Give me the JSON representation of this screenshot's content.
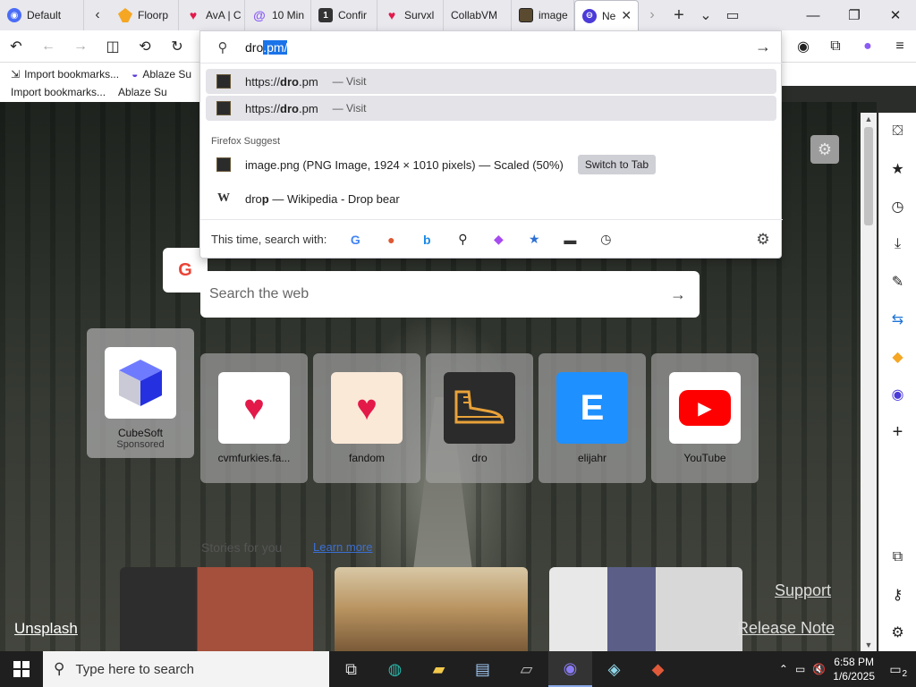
{
  "tabs": [
    {
      "label": "Default",
      "icon": "firefox-icon",
      "color": "#4a6cf7"
    },
    {
      "label": "Floorp",
      "icon": "floorp-icon",
      "color": "#f5a623"
    },
    {
      "label": "AvA | C",
      "icon": "fandom-icon",
      "color": "#e3194a"
    },
    {
      "label": "10 Min",
      "icon": "at-icon",
      "color": "#8a5cf5"
    },
    {
      "label": "Confir",
      "icon": "number-one-icon",
      "color": "#333333"
    },
    {
      "label": "Survxl",
      "icon": "fandom-icon",
      "color": "#e3194a"
    },
    {
      "label": "CollabVM",
      "icon": "",
      "color": ""
    },
    {
      "label": "image",
      "icon": "image-icon",
      "color": "#5a4a30"
    },
    {
      "label": "Ne",
      "icon": "proton-icon",
      "color": "#4b3bd8",
      "active": true
    }
  ],
  "url": {
    "typed": "dro",
    "selected": ".pm/"
  },
  "bookmarks": [
    {
      "label": "Import bookmarks...",
      "icon": "import-icon"
    },
    {
      "label": "Ablaze Su",
      "icon": "ablaze-icon"
    }
  ],
  "bookmarks_row2": [
    "Import bookmarks...",
    "Ablaze Su"
  ],
  "suggestions": [
    {
      "prefix": "https://",
      "bold": "dro",
      "suffix": ".pm",
      "action": "— Visit"
    },
    {
      "prefix": "https://",
      "bold": "dro",
      "suffix": ".pm",
      "action": "— Visit"
    }
  ],
  "section_label": "Firefox Suggest",
  "suggest_items": [
    {
      "text": "image.png (PNG Image, 1924 × 1010 pixels) — Scaled (50%)",
      "button": "Switch to Tab"
    },
    {
      "prefix": "dro",
      "bold": "p",
      "suffix": " — Wikipedia - Drop bear",
      "icon": "W"
    }
  ],
  "engines_label": "This time, search with:",
  "engines": [
    {
      "name": "google-engine-icon",
      "glyph": "G",
      "color": "#4285f4"
    },
    {
      "name": "duckduckgo-engine-icon",
      "glyph": "●",
      "color": "#de5833"
    },
    {
      "name": "bing-engine-icon",
      "glyph": "b",
      "color": "#1b8ae6"
    },
    {
      "name": "search-engine-icon",
      "glyph": "⚲",
      "color": "#222222"
    },
    {
      "name": "photo-engine-icon",
      "glyph": "◆",
      "color": "#a64bf0"
    },
    {
      "name": "bookmarks-engine-icon",
      "glyph": "★",
      "color": "#2b6fd4"
    },
    {
      "name": "tabs-engine-icon",
      "glyph": "▬",
      "color": "#333333"
    },
    {
      "name": "history-engine-icon",
      "glyph": "◷",
      "color": "#333333"
    }
  ],
  "websearch": {
    "placeholder": "Search the web"
  },
  "cube_tile": {
    "name": "CubeSoft",
    "sub": "Sponsored"
  },
  "tiles": [
    {
      "label": "cvmfurkies.fa...",
      "icon": "fandom-icon",
      "bg": "#ffffff",
      "glyph": "♥",
      "color": "#e3194a"
    },
    {
      "label": "fandom",
      "icon": "fandom-icon",
      "bg": "#fbe9d8",
      "glyph": "♥",
      "color": "#e3194a"
    },
    {
      "label": "dro",
      "icon": "boot-icon",
      "bg": "#2b2b2b",
      "glyph": "👢",
      "color": "#e8a23a"
    },
    {
      "label": "elijahr",
      "icon": "e-letter-icon",
      "bg": "#1e90ff",
      "glyph": "E",
      "color": "#ffffff"
    },
    {
      "label": "YouTube",
      "icon": "youtube-icon",
      "bg": "#ffffff",
      "glyph": "▶",
      "color": "#ff0000"
    }
  ],
  "page": {
    "unsplash": "Unsplash",
    "support": "Support",
    "release": "Release Note",
    "learn_more": "Learn more",
    "story_label": "Stories for you"
  },
  "taskbar": {
    "search_placeholder": "Type here to search",
    "time": "6:58 PM",
    "date": "1/6/2025",
    "notif_count": "2"
  }
}
